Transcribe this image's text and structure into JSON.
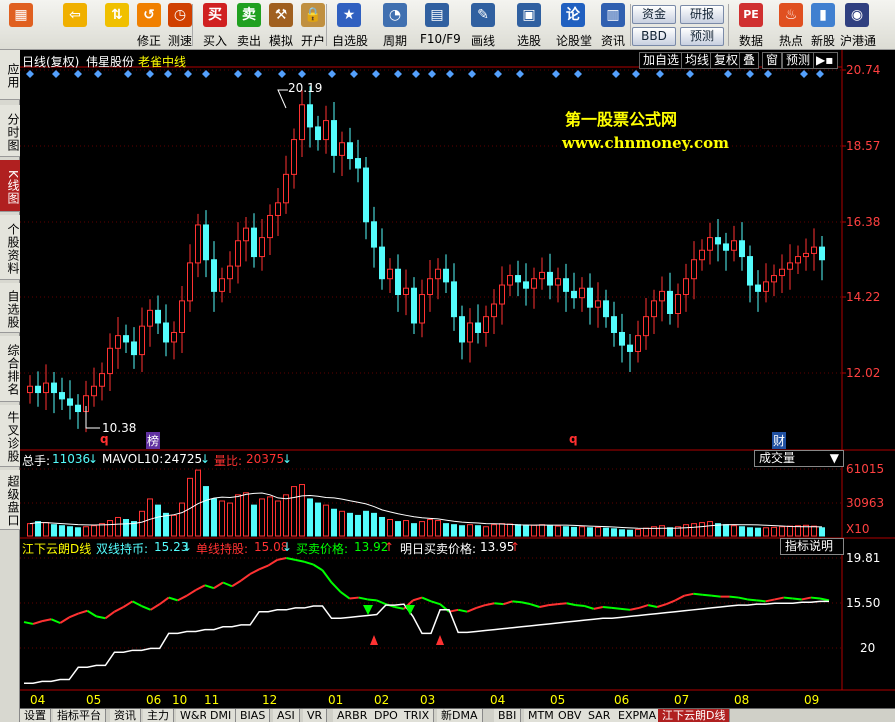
{
  "toolbar": {
    "buttons": [
      {
        "name": "home-button",
        "icon": "grid-icon",
        "label": ""
      },
      {
        "name": "back-button",
        "icon": "back-arrow-icon",
        "label": ""
      },
      {
        "name": "updown-button",
        "icon": "up-down-arrows-icon",
        "label": ""
      },
      {
        "name": "correct-button",
        "icon": "restore-icon",
        "label": "修正"
      },
      {
        "name": "countdown-button",
        "icon": "clock-icon",
        "label": "测速"
      },
      {
        "name": "buy-button",
        "icon": "buy-icon",
        "label": "买入",
        "glyph": "买"
      },
      {
        "name": "sell-button",
        "icon": "sell-icon",
        "label": "卖出",
        "glyph": "卖"
      },
      {
        "name": "simulate-button",
        "icon": "hammer-icon",
        "label": "模拟"
      },
      {
        "name": "open-account-button",
        "icon": "lock-icon",
        "label": "开户"
      },
      {
        "name": "watchlist-button",
        "icon": "star-icon",
        "label": "自选股"
      },
      {
        "name": "period-button",
        "icon": "cycle-icon",
        "label": "周期"
      },
      {
        "name": "f10-button",
        "icon": "document-icon",
        "label": "F10/F9"
      },
      {
        "name": "draw-button",
        "icon": "pen-icon",
        "label": "画线"
      },
      {
        "name": "select-stock-button",
        "icon": "monitor-icon",
        "label": "选股"
      },
      {
        "name": "forum-button",
        "icon": "lun-icon",
        "label": "论股堂",
        "glyph": "论"
      },
      {
        "name": "news-button",
        "icon": "news-icon",
        "label": "资讯"
      },
      {
        "name": "data-button",
        "icon": "pe-icon",
        "label": "数据",
        "glyph": "PE"
      },
      {
        "name": "hot-button",
        "icon": "fire-icon",
        "label": "热点"
      },
      {
        "name": "new-stock-button",
        "icon": "new-stock-icon",
        "label": "新股"
      },
      {
        "name": "hk-connect-button",
        "icon": "hk-icon",
        "label": "沪港通"
      }
    ],
    "wide_buttons": [
      "资金",
      "BBD",
      "研报",
      "预测"
    ]
  },
  "left_tabs": [
    "应用",
    "分时图",
    "K线图",
    "个股资料",
    "自选股",
    "综合排名",
    "牛叉诊股",
    "超级盘口"
  ],
  "left_tab_active": 2,
  "header": {
    "mode": "日线(复权)",
    "stock_name": "伟星股份",
    "indicator_name": "老雀中线",
    "buttons": [
      "加自选",
      "均线",
      "复权",
      "叠",
      "窗",
      "预测"
    ]
  },
  "watermark": {
    "line1": "第一股票公式网",
    "line2": "www.chnmoney.com"
  },
  "price_axis": [
    "20.74",
    "18.57",
    "16.38",
    "14.22",
    "12.02"
  ],
  "price_labels": {
    "high": "20.19",
    "low": "10.38"
  },
  "markers": [
    {
      "text": "q",
      "color": "#ff3030"
    },
    {
      "text": "榜",
      "color": "#c080ff"
    },
    {
      "text": "q",
      "color": "#ff3030"
    },
    {
      "text": "财",
      "color": "#60a0ff"
    }
  ],
  "volume": {
    "total_label": "总手:",
    "total_value": "11036",
    "mavol_label": "MAVOL10:",
    "mavol_value": "24725",
    "ratio_label": "量比:",
    "ratio_value": "20375",
    "dropdown": "成交量",
    "axis": [
      "61015",
      "30963"
    ],
    "unit": "X10"
  },
  "indicator": {
    "name": "江下云朗D线",
    "dual_label": "双线持币:",
    "dual_value": "15.23",
    "single_label": "单线持股:",
    "single_value": "15.08",
    "trade_label": "买卖价格:",
    "trade_value": "13.92",
    "tomorrow_label": "明日买卖价格:",
    "tomorrow_value": "13.95",
    "help_button": "指标说明",
    "axis": [
      "19.81",
      "15.50",
      "20"
    ]
  },
  "x_axis": [
    "04",
    "05",
    "06",
    "10",
    "11",
    "12",
    "01",
    "02",
    "03",
    "04",
    "05",
    "06",
    "07",
    "08",
    "09"
  ],
  "bottom_tabs": [
    "设置",
    "指标平台",
    "资讯",
    "主力",
    "W&R",
    "DMI",
    "BIAS",
    "ASI",
    "VR",
    "ARBR",
    "DPO",
    "TRIX",
    "新DMA",
    "BBI",
    "MTM",
    "OBV",
    "SAR",
    "EXPMA",
    "江下云朗D线"
  ],
  "bottom_tab_active": 18,
  "colors": {
    "up": "#ff3232",
    "down": "#54fcfc",
    "axis": "#b00000",
    "accent": "#ffff00",
    "line_white": "#ffffff",
    "line_green": "#00ff00"
  },
  "chart_data": {
    "type": "line",
    "title": "",
    "ylim": [
      9.5,
      21.2
    ],
    "close": [
      11.2,
      11.0,
      11.3,
      11.0,
      10.8,
      10.6,
      10.4,
      10.9,
      11.2,
      11.6,
      12.4,
      12.8,
      12.6,
      12.2,
      13.1,
      13.6,
      13.2,
      12.6,
      12.9,
      13.9,
      15.1,
      16.3,
      15.2,
      14.2,
      14.6,
      15.0,
      15.8,
      16.2,
      15.3,
      15.9,
      16.6,
      17.0,
      17.9,
      19.0,
      20.1,
      19.4,
      19.0,
      19.6,
      18.5,
      18.9,
      18.4,
      18.1,
      16.4,
      15.6,
      14.6,
      14.9,
      14.1,
      14.3,
      13.2,
      14.1,
      14.6,
      14.9,
      14.5,
      13.4,
      12.6,
      13.2,
      12.9,
      13.4,
      13.8,
      14.4,
      14.7,
      14.5,
      14.3,
      14.6,
      14.8,
      14.4,
      14.6,
      14.2,
      14.0,
      14.3,
      13.7,
      13.9,
      13.4,
      12.9,
      12.5,
      12.3,
      12.8,
      13.4,
      13.9,
      14.2,
      13.5,
      14.1,
      14.6,
      15.2,
      15.5,
      15.9,
      15.7,
      15.5,
      15.8,
      15.3,
      14.4,
      14.2,
      14.5,
      14.7,
      14.9,
      15.1,
      15.3,
      15.4,
      15.6,
      15.2
    ],
    "volume": [
      60,
      70,
      65,
      55,
      50,
      45,
      40,
      45,
      50,
      60,
      75,
      90,
      80,
      70,
      120,
      180,
      150,
      110,
      100,
      160,
      280,
      320,
      240,
      180,
      170,
      160,
      200,
      210,
      150,
      180,
      190,
      170,
      200,
      240,
      250,
      180,
      160,
      150,
      130,
      120,
      110,
      100,
      120,
      110,
      90,
      80,
      70,
      75,
      60,
      70,
      80,
      75,
      60,
      55,
      50,
      55,
      50,
      45,
      55,
      60,
      58,
      55,
      50,
      52,
      55,
      50,
      48,
      45,
      42,
      45,
      40,
      42,
      38,
      35,
      30,
      28,
      32,
      38,
      45,
      50,
      40,
      45,
      55,
      60,
      65,
      70,
      60,
      55,
      50,
      45,
      40,
      38,
      40,
      42,
      45,
      48,
      50,
      52,
      48,
      40
    ],
    "dual_line": [
      13.0,
      12.8,
      13.1,
      13.3,
      12.9,
      13.5,
      13.9,
      14.2,
      13.6,
      13.4,
      14.1,
      14.6,
      15.2,
      14.7,
      14.3,
      14.9,
      15.6,
      15.3,
      15.8,
      16.4,
      16.9,
      16.6,
      17.2,
      16.8,
      17.4,
      18.1,
      18.6,
      19.0,
      19.6,
      19.8,
      19.6,
      19.4,
      19.1,
      18.5,
      17.2,
      16.2,
      15.5,
      15.6,
      15.4,
      15.3,
      14.9,
      14.6,
      14.4,
      15.3,
      15.6,
      15.2,
      14.9,
      14.1,
      14.3,
      14.1,
      14.5,
      14.8,
      15.0,
      14.9,
      15.2,
      15.1,
      14.9,
      14.6,
      14.8,
      14.9,
      15.0,
      14.8,
      14.7,
      14.4,
      14.6,
      14.5,
      14.4,
      14.3,
      14.5,
      14.8,
      14.6,
      14.9,
      15.3,
      15.8,
      16.0,
      15.9,
      15.8,
      15.7,
      15.7,
      15.6,
      15.4,
      15.3,
      15.2,
      15.4,
      15.6,
      15.5,
      15.4,
      15.6,
      15.5,
      15.3
    ],
    "single_line": [
      6.5,
      6.5,
      6.7,
      6.7,
      6.9,
      6.9,
      8.2,
      8.2,
      8.4,
      8.4,
      9.8,
      9.8,
      10.0,
      10.0,
      10.2,
      10.2,
      11.8,
      11.8,
      12.0,
      12.0,
      12.2,
      12.2,
      12.5,
      12.5,
      12.7,
      12.7,
      14.1,
      14.1,
      14.3,
      14.3,
      14.5,
      14.5,
      14.7,
      14.7,
      13.4,
      13.4,
      13.5,
      13.6,
      13.7,
      13.8,
      14.8,
      14.8,
      14.9,
      13.6,
      11.8,
      11.8,
      14.3,
      14.3,
      11.9,
      11.9,
      12.0,
      12.1,
      12.2,
      12.3,
      12.4,
      12.5,
      12.6,
      12.7,
      12.8,
      12.9,
      13.0,
      13.1,
      13.2,
      13.3,
      13.4,
      13.4,
      13.5,
      13.6,
      13.7,
      13.8,
      13.9,
      14.0,
      14.1,
      14.2,
      14.3,
      14.4,
      14.5,
      14.6,
      14.7,
      14.8,
      14.8,
      14.9,
      14.9,
      15.0,
      15.0,
      15.0,
      15.1,
      15.1,
      15.2,
      15.2
    ]
  }
}
